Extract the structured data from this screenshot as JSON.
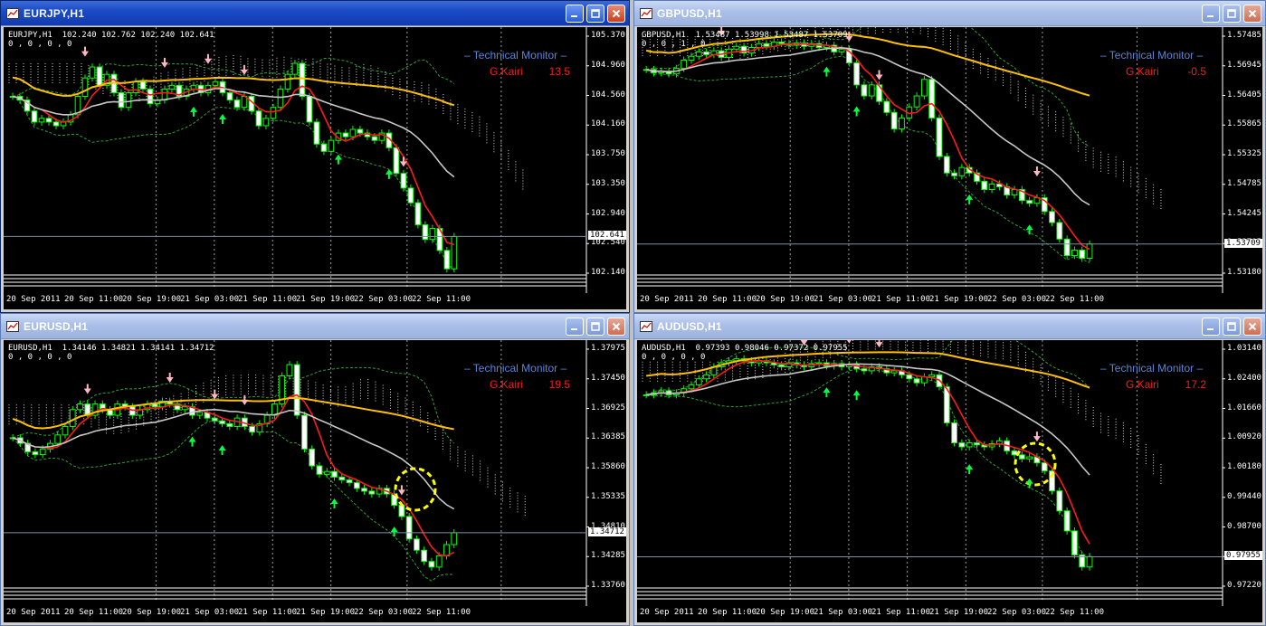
{
  "windows": [
    {
      "id": "eurjpy",
      "title": "EURJPY,H1",
      "active": true,
      "symbol_line": "EURJPY,H1  102.240 102.762 102.240 102.641",
      "indicator_line": "0 , 0 , 0 , 0",
      "monitor_label": "Technical  Monitor",
      "kairi_label": "G.Kairi",
      "kairi_value": "13.5",
      "y_labels": [
        "105.370",
        "104.960",
        "104.560",
        "104.160",
        "103.750",
        "103.350",
        "102.940",
        "102.540",
        "102.140"
      ],
      "current_price": "102.641",
      "x_labels": [
        "20 Sep 2011",
        "20 Sep 11:00",
        "20 Sep 19:00",
        "21 Sep 03:00",
        "21 Sep 11:00",
        "21 Sep 19:00",
        "22 Sep 03:00",
        "22 Sep 11:00"
      ],
      "chart_data": {
        "type": "candlestick",
        "ylim": [
          102.14,
          105.37
        ],
        "current": 102.641,
        "closes": [
          104.55,
          104.5,
          104.35,
          104.2,
          104.25,
          104.2,
          104.15,
          104.2,
          104.3,
          104.55,
          104.8,
          104.95,
          104.7,
          104.85,
          104.6,
          104.4,
          104.6,
          104.75,
          104.65,
          104.45,
          104.5,
          104.65,
          104.7,
          104.55,
          104.65,
          104.7,
          104.6,
          104.7,
          104.75,
          104.6,
          104.5,
          104.4,
          104.55,
          104.35,
          104.15,
          104.25,
          104.4,
          104.65,
          104.85,
          105.0,
          104.55,
          104.2,
          103.9,
          103.8,
          103.95,
          104.05,
          104.0,
          104.1,
          104.05,
          104.0,
          103.95,
          104.05,
          103.85,
          103.5,
          103.3,
          103.1,
          102.8,
          102.6,
          102.75,
          102.45,
          102.2,
          102.64
        ]
      }
    },
    {
      "id": "gbpusd",
      "title": "GBPUSD,H1",
      "active": false,
      "symbol_line": "GBPUSD,H1  1.53487 1.53998 1.53487 1.53709",
      "indicator_line": "0 , 0 , 1 , 0",
      "monitor_label": "Technical  Monitor",
      "kairi_label": "G.Kairi",
      "kairi_value": "-0.5",
      "y_labels": [
        "1.57485",
        "1.56945",
        "1.56405",
        "1.55865",
        "1.55325",
        "1.54785",
        "1.54245",
        "1.53705",
        "1.53180"
      ],
      "current_price": "1.53709",
      "x_labels": [
        "20 Sep 2011",
        "20 Sep 11:00",
        "20 Sep 19:00",
        "21 Sep 03:00",
        "21 Sep 11:00",
        "21 Sep 19:00",
        "22 Sep 03:00",
        "22 Sep 11:00"
      ],
      "chart_data": {
        "type": "candlestick",
        "ylim": [
          1.5318,
          1.57485
        ],
        "current": 1.53709,
        "closes": [
          1.5688,
          1.5682,
          1.5685,
          1.568,
          1.569,
          1.5705,
          1.5712,
          1.572,
          1.5715,
          1.5722,
          1.571,
          1.5725,
          1.573,
          1.5718,
          1.5728,
          1.5735,
          1.573,
          1.5738,
          1.5735,
          1.5732,
          1.5736,
          1.573,
          1.5735,
          1.5728,
          1.5732,
          1.572,
          1.5725,
          1.57,
          1.566,
          1.564,
          1.566,
          1.563,
          1.561,
          1.558,
          1.56,
          1.562,
          1.564,
          1.567,
          1.56,
          1.553,
          1.55,
          1.5495,
          1.551,
          1.55,
          1.5485,
          1.547,
          1.548,
          1.5475,
          1.546,
          1.547,
          1.545,
          1.5445,
          1.5455,
          1.543,
          1.541,
          1.538,
          1.535,
          1.536,
          1.5345,
          1.5371
        ]
      }
    },
    {
      "id": "eurusd",
      "title": "EURUSD,H1",
      "active": false,
      "symbol_line": "EURUSD,H1  1.34146 1.34821 1.34141 1.34712",
      "indicator_line": "0 , 0 , 0 , 0",
      "monitor_label": "Technical  Monitor",
      "kairi_label": "G.Kairi",
      "kairi_value": "19.5",
      "y_labels": [
        "1.37975",
        "1.37450",
        "1.36925",
        "1.36385",
        "1.35860",
        "1.35335",
        "1.34810",
        "1.34285",
        "1.33760"
      ],
      "current_price": "1.34712",
      "x_labels": [
        "20 Sep 2011",
        "20 Sep 11:00",
        "20 Sep 19:00",
        "21 Sep 03:00",
        "21 Sep 11:00",
        "21 Sep 19:00",
        "22 Sep 03:00",
        "22 Sep 11:00"
      ],
      "chart_data": {
        "type": "candlestick",
        "ylim": [
          1.3376,
          1.37975
        ],
        "current": 1.34712,
        "closes": [
          1.364,
          1.363,
          1.3615,
          1.361,
          1.362,
          1.363,
          1.3645,
          1.366,
          1.369,
          1.37,
          1.368,
          1.37,
          1.369,
          1.368,
          1.37,
          1.3695,
          1.368,
          1.369,
          1.37,
          1.3695,
          1.3705,
          1.37,
          1.369,
          1.3695,
          1.368,
          1.3685,
          1.3675,
          1.367,
          1.3665,
          1.366,
          1.3675,
          1.366,
          1.365,
          1.3665,
          1.368,
          1.37,
          1.375,
          1.377,
          1.368,
          1.362,
          1.359,
          1.3575,
          1.358,
          1.357,
          1.3565,
          1.356,
          1.355,
          1.3545,
          1.354,
          1.355,
          1.354,
          1.352,
          1.35,
          1.346,
          1.344,
          1.342,
          1.341,
          1.343,
          1.345,
          1.3471
        ]
      }
    },
    {
      "id": "audusd",
      "title": "AUDUSD,H1",
      "active": false,
      "symbol_line": "AUDUSD,H1  0.97393 0.98046 0.97372 0.97955",
      "indicator_line": "0 , 0 , 0 , 0",
      "monitor_label": "Technical  Monitor",
      "kairi_label": "G.Kairi",
      "kairi_value": "17.2",
      "y_labels": [
        "1.03140",
        "1.02400",
        "1.01660",
        "1.00920",
        "1.00180",
        "0.99440",
        "0.98700",
        "0.97955",
        "0.97220"
      ],
      "current_price": "0.97955",
      "x_labels": [
        "20 Sep 2011",
        "20 Sep 11:00",
        "20 Sep 19:00",
        "21 Sep 03:00",
        "21 Sep 11:00",
        "21 Sep 19:00",
        "22 Sep 03:00",
        "22 Sep 11:00"
      ],
      "chart_data": {
        "type": "candlestick",
        "ylim": [
          0.9722,
          1.0314
        ],
        "current": 0.97955,
        "closes": [
          1.02,
          1.0205,
          1.021,
          1.02,
          1.0205,
          1.0215,
          1.0225,
          1.024,
          1.025,
          1.027,
          1.028,
          1.0285,
          1.029,
          1.0285,
          1.028,
          1.0285,
          1.028,
          1.0275,
          1.027,
          1.028,
          1.0275,
          1.027,
          1.0278,
          1.028,
          1.0272,
          1.0278,
          1.027,
          1.0275,
          1.0265,
          1.026,
          1.027,
          1.0265,
          1.0255,
          1.026,
          1.025,
          1.024,
          1.023,
          1.0245,
          1.025,
          1.022,
          1.013,
          1.008,
          1.007,
          1.008,
          1.0075,
          1.007,
          1.0078,
          1.0085,
          1.006,
          1.005,
          1.004,
          1.0045,
          1.003,
          1.001,
          0.996,
          0.991,
          0.986,
          0.98,
          0.977,
          0.9796
        ]
      }
    }
  ]
}
